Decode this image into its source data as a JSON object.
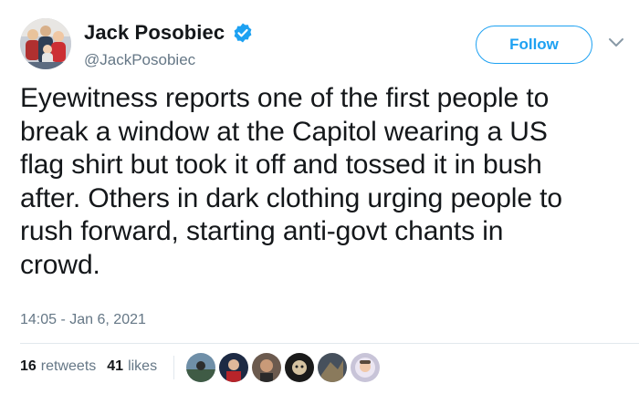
{
  "user": {
    "display_name": "Jack Posobiec",
    "handle": "@JackPosobiec",
    "verified": true,
    "avatar_icon": "profile-photo-family"
  },
  "follow_button": {
    "label": "Follow"
  },
  "menu": {
    "icon": "chevron-down-icon"
  },
  "tweet": {
    "text": "Eyewitness reports one of the first people to\nbreak a window at the Capitol wearing a US\nflag shirt but took it off and tossed it in bush\nafter. Others in dark clothing urging people to\nrush forward, starting anti-govt chants in\ncrowd.",
    "timestamp": "14:05 - Jan 6, 2021"
  },
  "stats": {
    "retweets_count": "16",
    "retweets_label": "retweets",
    "likes_count": "41",
    "likes_label": "likes"
  },
  "likers": [
    {
      "icon": "liker-avatar-1"
    },
    {
      "icon": "liker-avatar-2"
    },
    {
      "icon": "liker-avatar-3"
    },
    {
      "icon": "liker-avatar-4"
    },
    {
      "icon": "liker-avatar-5"
    },
    {
      "icon": "liker-avatar-6"
    }
  ],
  "colors": {
    "accent": "#1da1f2",
    "text_primary": "#14171a",
    "text_secondary": "#657786",
    "divider": "#e1e8ed"
  }
}
